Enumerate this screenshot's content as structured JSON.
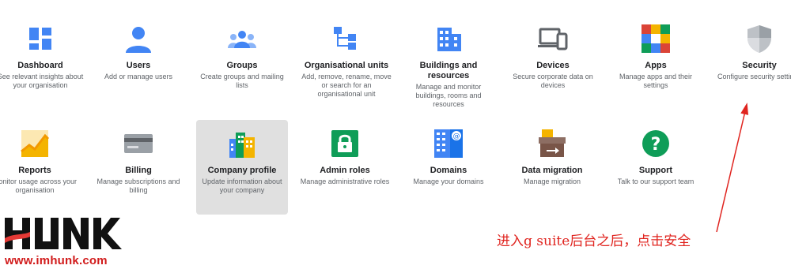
{
  "tiles": [
    {
      "title": "Dashboard",
      "desc": "See relevant insights about your organisation",
      "icon": "dashboard-icon"
    },
    {
      "title": "Users",
      "desc": "Add or manage users",
      "icon": "user-icon"
    },
    {
      "title": "Groups",
      "desc": "Create groups and mailing lists",
      "icon": "groups-icon"
    },
    {
      "title": "Organisational units",
      "desc": "Add, remove, rename, move or search for an organisational unit",
      "icon": "org-units-icon"
    },
    {
      "title": "Buildings and resources",
      "desc": "Manage and monitor buildings, rooms and resources",
      "icon": "building-icon"
    },
    {
      "title": "Devices",
      "desc": "Secure corporate data on devices",
      "icon": "devices-icon"
    },
    {
      "title": "Apps",
      "desc": "Manage apps and their settings",
      "icon": "apps-icon"
    },
    {
      "title": "Security",
      "desc": "Configure security settings",
      "icon": "shield-icon"
    },
    {
      "title": "Reports",
      "desc": "Monitor usage across your organisation",
      "icon": "reports-chart-icon"
    },
    {
      "title": "Billing",
      "desc": "Manage subscriptions and billing",
      "icon": "credit-card-icon"
    },
    {
      "title": "Company profile",
      "desc": "Update information about your company",
      "icon": "company-building-icon"
    },
    {
      "title": "Admin roles",
      "desc": "Manage administrative roles",
      "icon": "lock-icon"
    },
    {
      "title": "Domains",
      "desc": "Manage your domains",
      "icon": "domains-icon"
    },
    {
      "title": "Data migration",
      "desc": "Manage migration",
      "icon": "migration-box-icon"
    },
    {
      "title": "Support",
      "desc": "Talk to our support team",
      "icon": "help-icon"
    }
  ],
  "watermark": {
    "logo_text": "HUNK",
    "site": "www.imhunk.com"
  },
  "annotation": "进入g suite后台之后，点击安全",
  "colors": {
    "blue": "#4285f4",
    "green": "#0f9d58",
    "yellow": "#f4b400",
    "red": "#db4437",
    "annotation": "#e0241f",
    "selected_bg": "#e0e0e0"
  }
}
